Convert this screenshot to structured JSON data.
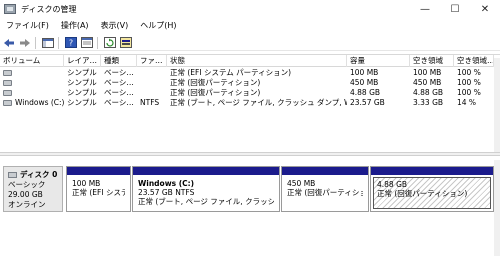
{
  "window": {
    "title": "ディスクの管理",
    "minimize_glyph": "—",
    "maximize_glyph": "☐",
    "close_glyph": "✕"
  },
  "menu": {
    "items": [
      "ファイル(F)",
      "操作(A)",
      "表示(V)",
      "ヘルプ(H)"
    ]
  },
  "toolbar": {
    "icons": [
      "back-arrow-icon",
      "forward-arrow-icon",
      "console-tree-icon",
      "help-icon",
      "properties-icon",
      "refresh-icon",
      "disk-properties-icon"
    ]
  },
  "volume_list": {
    "columns": [
      "ボリューム",
      "レイアウト",
      "種類",
      "ファイル システム",
      "状態",
      "容量",
      "空き領域",
      "空き領域の割合"
    ],
    "columns_display": [
      "ボリューム",
      "レイア…",
      "種類",
      "ファ…",
      "状態",
      "容量",
      "空き領域",
      "空き領域…"
    ],
    "rows": [
      {
        "volume": "",
        "layout": "シンプル",
        "type": "ベーシ…",
        "fs": "",
        "status": "正常 (EFI システム パーティション)",
        "capacity": "100 MB",
        "free": "100 MB",
        "pct": "100 %"
      },
      {
        "volume": "",
        "layout": "シンプル",
        "type": "ベーシ…",
        "fs": "",
        "status": "正常 (回復パーティション)",
        "capacity": "450 MB",
        "free": "450 MB",
        "pct": "100 %"
      },
      {
        "volume": "",
        "layout": "シンプル",
        "type": "ベーシ…",
        "fs": "",
        "status": "正常 (回復パーティション)",
        "capacity": "4.88 GB",
        "free": "4.88 GB",
        "pct": "100 %"
      },
      {
        "volume": "Windows (C:)",
        "layout": "シンプル",
        "type": "ベーシ…",
        "fs": "NTFS",
        "status": "正常 (ブート, ページ ファイル, クラッシュ ダンプ, Wim ブー…",
        "capacity": "23.57 GB",
        "free": "3.33 GB",
        "pct": "14 %"
      }
    ]
  },
  "disk": {
    "name": "ディスク 0",
    "type": "ベーシック",
    "size": "29.00 GB",
    "state": "オンライン",
    "partitions": [
      {
        "name": "",
        "size": "100 MB",
        "status": "正常 (EFI システム"
      },
      {
        "name": "Windows (C:)",
        "size": "23.57 GB NTFS",
        "status": "正常 (ブート, ページ ファイル, クラッシュ ダンプ,"
      },
      {
        "name": "",
        "size": "450 MB",
        "status": "正常 (回復パーティション)"
      },
      {
        "name": "",
        "size": "4.88 GB",
        "status": "正常 (回復パーティション)"
      }
    ]
  },
  "colors": {
    "partition_bar": "#1b1b8c",
    "background": "#ffffff"
  }
}
